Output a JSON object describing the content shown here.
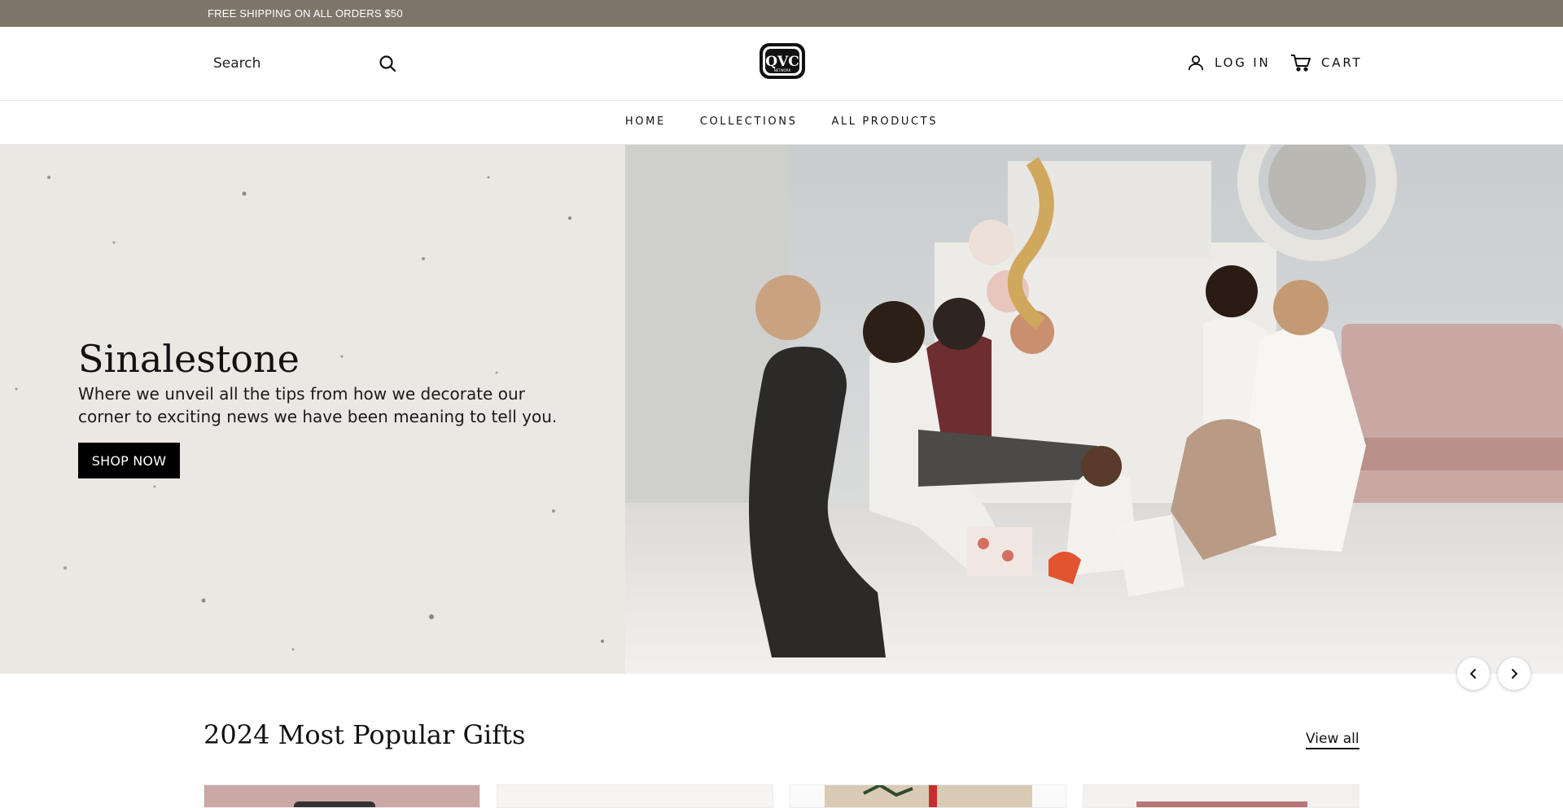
{
  "announcement": {
    "text": "FREE SHIPPING ON ALL ORDERS $50"
  },
  "header": {
    "search_placeholder": "Search",
    "logo": {
      "text": "QVC",
      "subtext": "NETWORK"
    },
    "login_label": "LOG IN",
    "cart_label": "CART"
  },
  "nav": {
    "items": [
      "HOME",
      "COLLECTIONS",
      "ALL PRODUCTS"
    ]
  },
  "hero": {
    "title": "Sinalestone",
    "subtitle": "Where we unveil all the tips from how we decorate our corner to exciting news we have been meaning to tell you.",
    "cta_label": "SHOP NOW"
  },
  "products_section": {
    "title": "2024 Most Popular Gifts",
    "view_all_label": "View all"
  },
  "colors": {
    "announcement_bg": "#7e766a",
    "button_bg": "#000000",
    "hero_left_bg": "#ebe8e3"
  }
}
